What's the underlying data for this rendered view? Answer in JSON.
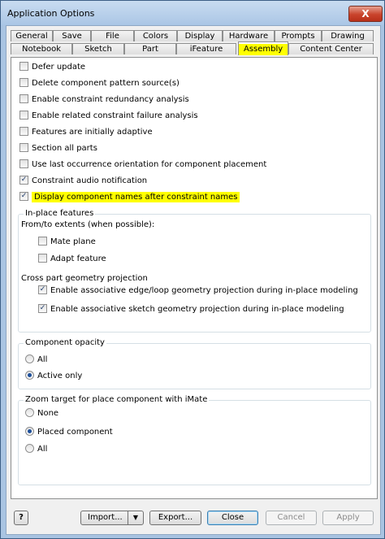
{
  "window": {
    "title": "Application Options",
    "close_glyph": "X"
  },
  "tabs_row1": [
    "General",
    "Save",
    "File",
    "Colors",
    "Display",
    "Hardware",
    "Prompts",
    "Drawing"
  ],
  "tabs_row2": [
    "Notebook",
    "Sketch",
    "Part",
    "iFeature",
    "Assembly",
    "Content Center"
  ],
  "active_tab": "Assembly",
  "options": [
    {
      "label": "Defer update",
      "checked": false
    },
    {
      "label": "Delete component pattern source(s)",
      "checked": false
    },
    {
      "label": "Enable constraint redundancy analysis",
      "checked": false
    },
    {
      "label": "Enable related constraint failure analysis",
      "checked": false
    },
    {
      "label": "Features are initially adaptive",
      "checked": false
    },
    {
      "label": "Section all parts",
      "checked": false
    },
    {
      "label": "Use last occurrence orientation for component placement",
      "checked": false
    },
    {
      "label": "Constraint audio notification",
      "checked": true
    },
    {
      "label": "Display component names after constraint names",
      "checked": true,
      "highlighted": true
    }
  ],
  "inplace": {
    "group_label": "In-place features",
    "extents_label": "From/to extents (when possible):",
    "mate_plane": {
      "label": "Mate plane",
      "checked": false
    },
    "adapt_feature": {
      "label": "Adapt feature",
      "checked": false
    },
    "projection_label": "Cross part geometry projection",
    "assoc_edge": {
      "label": "Enable associative edge/loop geometry projection during in-place modeling",
      "checked": true
    },
    "assoc_sketch": {
      "label": "Enable associative sketch geometry projection during in-place modeling",
      "checked": true
    }
  },
  "opacity": {
    "group_label": "Component opacity",
    "options": [
      {
        "label": "All",
        "selected": false
      },
      {
        "label": "Active only",
        "selected": true
      }
    ]
  },
  "zoom": {
    "group_label": "Zoom target for place component with iMate",
    "options": [
      {
        "label": "None",
        "selected": false
      },
      {
        "label": "Placed component",
        "selected": true
      },
      {
        "label": "All",
        "selected": false
      }
    ]
  },
  "buttons": {
    "help": "?",
    "import": "Import...",
    "import_arrow": "▼",
    "export": "Export...",
    "close": "Close",
    "cancel": "Cancel",
    "apply": "Apply"
  },
  "colors": {
    "highlight": "#ffff00",
    "title_bar": "#aac6e5",
    "close_button": "#c9432b"
  }
}
